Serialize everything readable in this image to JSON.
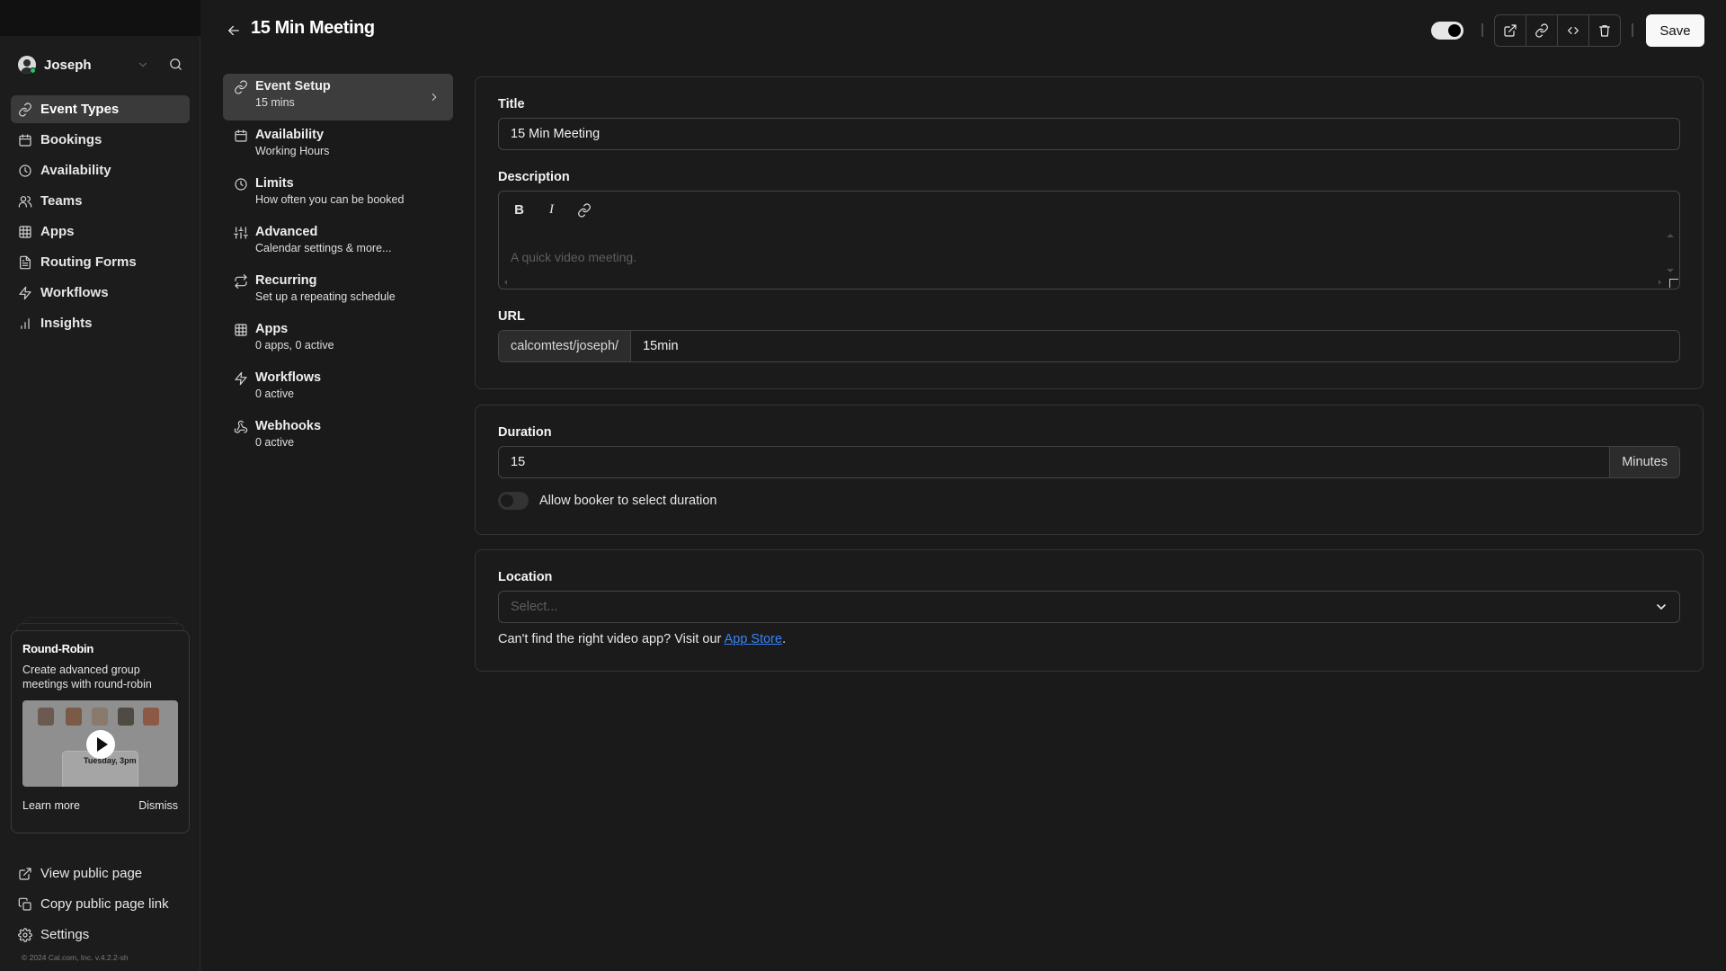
{
  "user": {
    "name": "Joseph",
    "status": "online"
  },
  "sidebar": {
    "items": [
      {
        "label": "Event Types",
        "icon": "link-icon",
        "active": true
      },
      {
        "label": "Bookings",
        "icon": "calendar-icon",
        "active": false
      },
      {
        "label": "Availability",
        "icon": "clock-icon",
        "active": false
      },
      {
        "label": "Teams",
        "icon": "users-icon",
        "active": false
      },
      {
        "label": "Apps",
        "icon": "grid-icon",
        "active": false
      },
      {
        "label": "Routing Forms",
        "icon": "file-text-icon",
        "active": false
      },
      {
        "label": "Workflows",
        "icon": "zap-icon",
        "active": false
      },
      {
        "label": "Insights",
        "icon": "bar-chart-icon",
        "active": false
      }
    ],
    "promo": {
      "title": "Round-Robin",
      "description": "Create advanced group meetings with round-robin",
      "thumbnail_caption": "Tuesday, 3pm",
      "learn_more": "Learn more",
      "dismiss": "Dismiss"
    },
    "footer": [
      {
        "label": "View public page",
        "icon": "external-link-icon"
      },
      {
        "label": "Copy public page link",
        "icon": "copy-icon"
      },
      {
        "label": "Settings",
        "icon": "gear-icon"
      }
    ],
    "copyright": "© 2024 Cal.com, Inc. v.4.2.2-sh"
  },
  "header": {
    "title": "15 Min Meeting",
    "hidden_toggle_on": true,
    "actions": [
      {
        "name": "preview",
        "icon": "external-link-icon"
      },
      {
        "name": "copy-link",
        "icon": "link-icon"
      },
      {
        "name": "embed",
        "icon": "code-icon"
      },
      {
        "name": "delete",
        "icon": "trash-icon"
      }
    ],
    "save_label": "Save"
  },
  "subnav": {
    "items": [
      {
        "title": "Event Setup",
        "desc": "15 mins",
        "icon": "link-icon",
        "active": true
      },
      {
        "title": "Availability",
        "desc": "Working Hours",
        "icon": "calendar-icon"
      },
      {
        "title": "Limits",
        "desc": "How often you can be booked",
        "icon": "clock-icon"
      },
      {
        "title": "Advanced",
        "desc": "Calendar settings & more...",
        "icon": "sliders-icon"
      },
      {
        "title": "Recurring",
        "desc": "Set up a repeating schedule",
        "icon": "repeat-icon"
      },
      {
        "title": "Apps",
        "desc": "0 apps, 0 active",
        "icon": "grid-icon"
      },
      {
        "title": "Workflows",
        "desc": "0 active",
        "icon": "zap-icon"
      },
      {
        "title": "Webhooks",
        "desc": "0 active",
        "icon": "webhook-icon"
      }
    ]
  },
  "form": {
    "title_label": "Title",
    "title_value": "15 Min Meeting",
    "description_label": "Description",
    "description_placeholder": "A quick video meeting.",
    "editor_tools": {
      "bold": "B",
      "italic": "I"
    },
    "url_label": "URL",
    "url_prefix": "calcomtest/joseph/",
    "url_slug": "15min",
    "duration_label": "Duration",
    "duration_value": "15",
    "duration_unit": "Minutes",
    "allow_booker_label": "Allow booker to select duration",
    "allow_booker_on": false,
    "location_label": "Location",
    "location_placeholder": "Select...",
    "location_help_prefix": "Can't find the right video app? Visit our ",
    "location_help_link": "App Store",
    "location_help_suffix": "."
  }
}
